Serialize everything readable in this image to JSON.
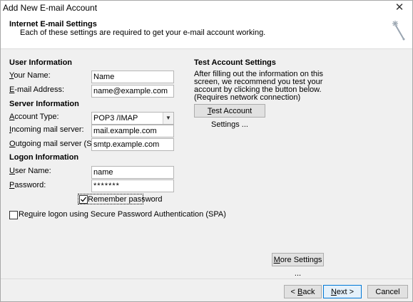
{
  "window": {
    "title": "Add New E-mail Account",
    "close_glyph": "✕"
  },
  "header": {
    "title": "Internet E-mail Settings",
    "subtitle": "Each of these settings are required to get your e-mail account working."
  },
  "user_info": {
    "heading": "User Information",
    "your_name_label": "Your Name:",
    "your_name_value": "Name",
    "email_label": "E-mail Address:",
    "email_value": "name@example.com"
  },
  "server_info": {
    "heading": "Server Information",
    "account_type_label": "Account Type:",
    "account_type_value": "POP3 /IMAP",
    "incoming_label": "Incoming mail server:",
    "incoming_value": "mail.example.com",
    "outgoing_label": "Outgoing mail server (SMTP):",
    "outgoing_value": "smtp.example.com"
  },
  "logon_info": {
    "heading": "Logon Information",
    "username_label": "User Name:",
    "username_value": "name",
    "password_label": "Password:",
    "password_value": "*******",
    "remember_label": "Remember password",
    "remember_checked": true,
    "spa_label": "Require logon using Secure Password Authentication (SPA)",
    "spa_checked": false
  },
  "test_settings": {
    "heading": "Test Account Settings",
    "description": "After filling out the information on this screen, we recommend you test your account by clicking the button below. (Requires network connection)",
    "button_label": "Test Account Settings ..."
  },
  "more_settings_label": "More Settings ...",
  "footer": {
    "back_label": "< Back",
    "next_label": "Next >",
    "cancel_label": "Cancel"
  },
  "icons": {
    "wizard": "sparkle-wizard-icon",
    "dropdown": "chevron-down-icon",
    "check": "checkmark-icon"
  }
}
